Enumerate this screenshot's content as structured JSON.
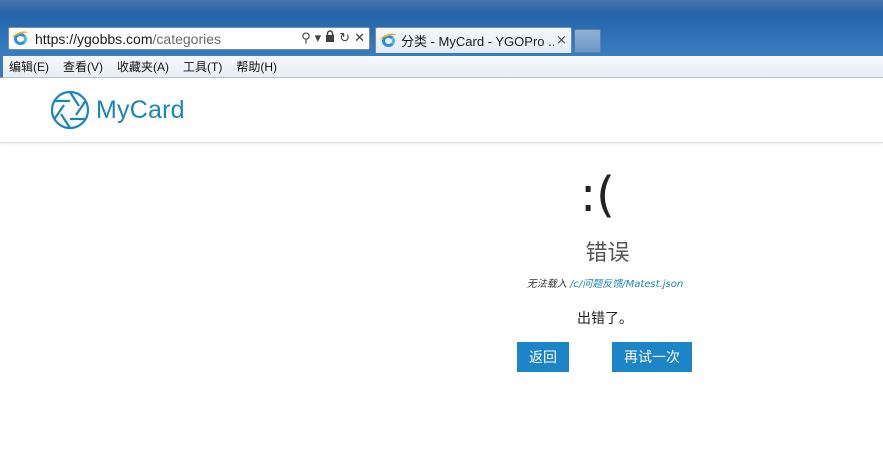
{
  "browser": {
    "address": {
      "url_main": "https://ygobbs.com",
      "url_path": "/categories"
    },
    "tab": {
      "title": "分类 - MyCard - YGOPro ...",
      "close": "×"
    },
    "addr_tools": {
      "search": "⚲",
      "dropdown": "▾",
      "lock": "🔒",
      "refresh": "↻",
      "stop": "✕"
    },
    "menu": [
      {
        "label": "编辑(E)"
      },
      {
        "label": "查看(V)"
      },
      {
        "label": "收藏夹(A)"
      },
      {
        "label": "工具(T)"
      },
      {
        "label": "帮助(H)"
      }
    ]
  },
  "site": {
    "logo_text": "MyCard",
    "brand_color": "#1a86b8"
  },
  "error": {
    "face": ":(",
    "title": "错误",
    "detail_prefix": "无法载入 ",
    "detail_link": "/c/问题反馈/Matest.json",
    "message": "出错了。",
    "back_label": "返回",
    "retry_label": "再试一次",
    "button_color": "#1b85c7"
  }
}
